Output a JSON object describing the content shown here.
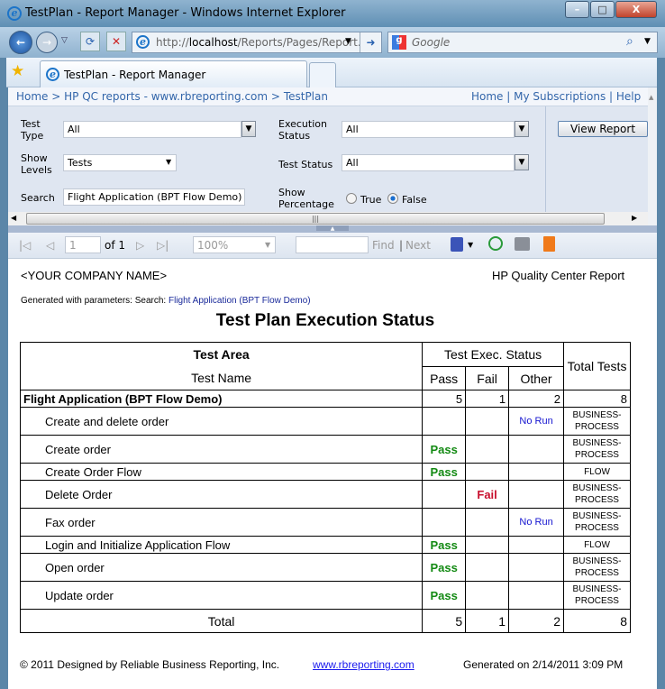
{
  "window": {
    "title": "TestPlan - Report Manager - Windows Internet Explorer",
    "min": "–",
    "max": "□",
    "close": "X"
  },
  "browser": {
    "url_prefix": "http://",
    "url_host": "localhost",
    "url_path": "/Reports/Pages/Report.",
    "search_placeholder": "Google",
    "tab_title": "TestPlan - Report Manager"
  },
  "breadcrumb": {
    "items": [
      "Home",
      "HP QC reports - www.rbreporting.com",
      "TestPlan"
    ],
    "sep": ">",
    "links": [
      "Home",
      "My Subscriptions",
      "Help"
    ]
  },
  "params": {
    "test_type_label": "Test Type",
    "test_type": "All",
    "exec_status_label": "Execution Status",
    "exec_status": "All",
    "show_levels_label": "Show Levels",
    "show_levels": "Tests",
    "test_status_label": "Test Status",
    "test_status": "All",
    "search_label": "Search",
    "search": "Flight Application (BPT Flow Demo)",
    "show_pct_label": "Show Percentage",
    "true_label": "True",
    "false_label": "False",
    "selected": "False",
    "view_report": "View Report"
  },
  "toolbar": {
    "page": "1",
    "of": "of 1",
    "zoom": "100%",
    "find": "Find",
    "next": "Next",
    "sep": "|"
  },
  "report": {
    "company": "<YOUR COMPANY NAME>",
    "brand": "HP Quality Center Report",
    "gen_params_label": "Generated with parameters: Search:",
    "gen_params_value": "Flight Application (BPT Flow Demo)",
    "title": "Test Plan Execution Status",
    "headers": {
      "area": "Test Area",
      "name": "Test Name",
      "exec": "Test Exec. Status",
      "pass": "Pass",
      "fail": "Fail",
      "other": "Other",
      "total": "Total Tests"
    },
    "group": {
      "name": "Flight Application (BPT Flow Demo)",
      "pass": "5",
      "fail": "1",
      "other": "2",
      "total": "8"
    },
    "rows": [
      {
        "name": "Create and delete order",
        "pass": "",
        "fail": "",
        "other": "No Run",
        "type": "BUSINESS-PROCESS"
      },
      {
        "name": "Create order",
        "pass": "Pass",
        "fail": "",
        "other": "",
        "type": "BUSINESS-PROCESS"
      },
      {
        "name": "Create Order Flow",
        "pass": "Pass",
        "fail": "",
        "other": "",
        "type": "FLOW"
      },
      {
        "name": "Delete Order",
        "pass": "",
        "fail": "Fail",
        "other": "",
        "type": "BUSINESS-PROCESS"
      },
      {
        "name": "Fax order",
        "pass": "",
        "fail": "",
        "other": "No Run",
        "type": "BUSINESS-PROCESS"
      },
      {
        "name": "Login and Initialize Application Flow",
        "pass": "Pass",
        "fail": "",
        "other": "",
        "type": "FLOW"
      },
      {
        "name": "Open order",
        "pass": "Pass",
        "fail": "",
        "other": "",
        "type": "BUSINESS-PROCESS"
      },
      {
        "name": "Update order",
        "pass": "Pass",
        "fail": "",
        "other": "",
        "type": "BUSINESS-PROCESS"
      }
    ],
    "total": {
      "label": "Total",
      "pass": "5",
      "fail": "1",
      "other": "2",
      "total": "8"
    },
    "footer": {
      "copyright": "© 2011 Designed by Reliable Business Reporting, Inc.",
      "link": "www.rbreporting.com",
      "generated": "Generated on 2/14/2011 3:09 PM"
    }
  }
}
